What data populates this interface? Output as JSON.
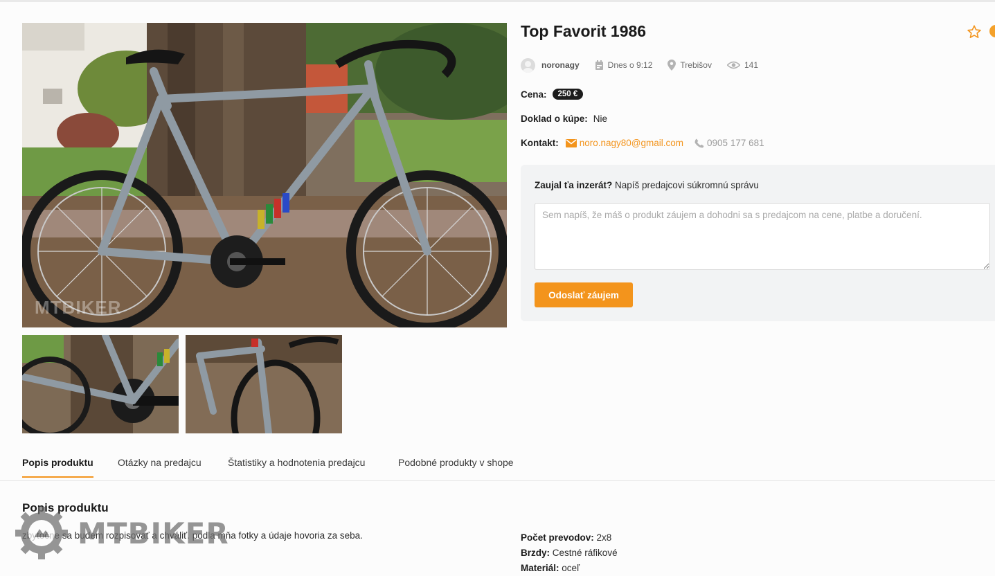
{
  "product": {
    "title": "Top Favorit 1986",
    "photo_watermark": "MTBIKER"
  },
  "meta": {
    "username": "noronagy",
    "posted": "Dnes o 9:12",
    "location": "Trebišov",
    "views": "141"
  },
  "details": {
    "price_label": "Cena:",
    "price_value": "250 €",
    "receipt_label": "Doklad o kúpe:",
    "receipt_value": "Nie",
    "contact_label": "Kontakt:",
    "email": "noro.nagy80@gmail.com",
    "phone": "0905 177 681"
  },
  "contact_form": {
    "question_bold": "Zaujal ťa inzerát?",
    "question_rest": "Napíš predajcovi súkromnú správu",
    "placeholder": "Sem napíš, že máš o produkt záujem a dohodni sa s predajcom na cene, platbe a doručení.",
    "submit_label": "Odoslať záujem"
  },
  "tabs": [
    {
      "label": "Popis produktu",
      "active": true
    },
    {
      "label": "Otázky na predajcu",
      "active": false
    },
    {
      "label": "Štatistiky a hodnotenia predajcu",
      "active": false
    },
    {
      "label": "Podobné produkty v shope",
      "active": false
    }
  ],
  "description": {
    "heading": "Popis produktu",
    "text": "zbytočne sa budem rozpisovať a chváliť. podla mňa fotky a údaje hovoria za seba.",
    "specs": [
      {
        "key": "Počet prevodov:",
        "value": "2x8"
      },
      {
        "key": "Brzdy:",
        "value": "Cestné ráfikové"
      },
      {
        "key": "Materiál:",
        "value": "oceľ"
      }
    ]
  },
  "watermark": {
    "text": "MTBIKER"
  },
  "colors": {
    "accent": "#f3941c",
    "price_badge": "#1c1c1c",
    "panel": "#f2f3f4"
  },
  "icons": [
    "star-icon",
    "calendar-icon",
    "location-pin-icon",
    "eye-icon",
    "mail-icon",
    "phone-icon",
    "gear-logo-icon"
  ]
}
